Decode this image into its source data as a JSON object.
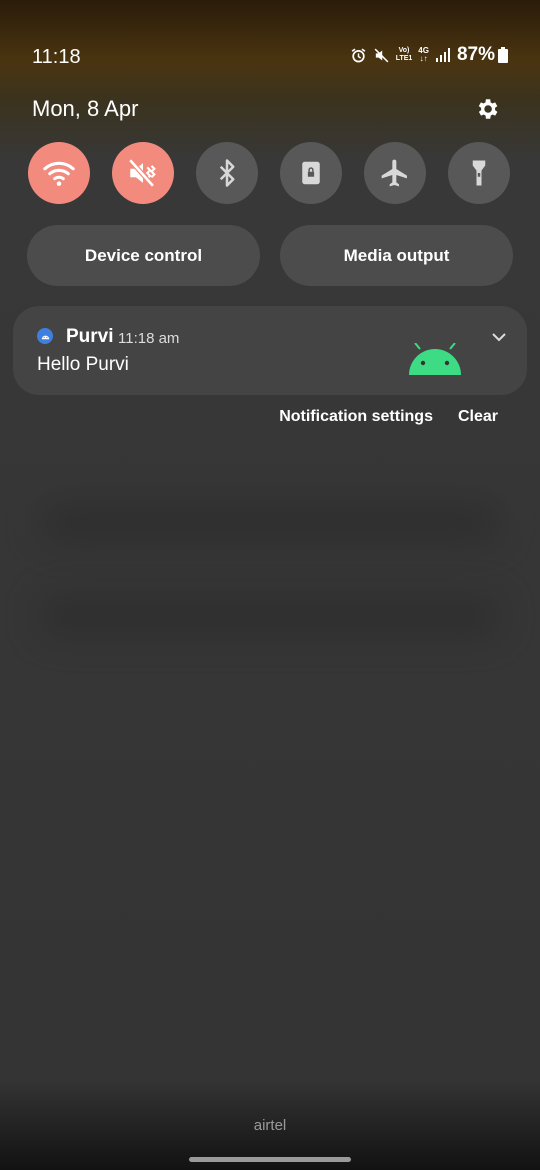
{
  "status_bar": {
    "time": "11:18",
    "volte_line1": "Vo)",
    "volte_line2": "LTE1",
    "network": "4G",
    "battery": "87%"
  },
  "header": {
    "date": "Mon, 8 Apr"
  },
  "quick_settings": [
    {
      "name": "wifi",
      "on": true
    },
    {
      "name": "mute",
      "on": true
    },
    {
      "name": "bluetooth",
      "on": false
    },
    {
      "name": "rotation-lock",
      "on": false
    },
    {
      "name": "airplane-mode",
      "on": false
    },
    {
      "name": "flashlight",
      "on": false
    }
  ],
  "pills": {
    "device_control": "Device control",
    "media_output": "Media output"
  },
  "notification": {
    "app": "Purvi",
    "time": "11:18 am",
    "text": "Hello Purvi"
  },
  "notification_actions": {
    "settings": "Notification settings",
    "clear": "Clear"
  },
  "carrier": "airtel",
  "colors": {
    "active_tile": "#f28b7e",
    "inactive_tile": "#585858",
    "android_green": "#3ddc84",
    "app_icon_blue": "#3f7fe0"
  }
}
